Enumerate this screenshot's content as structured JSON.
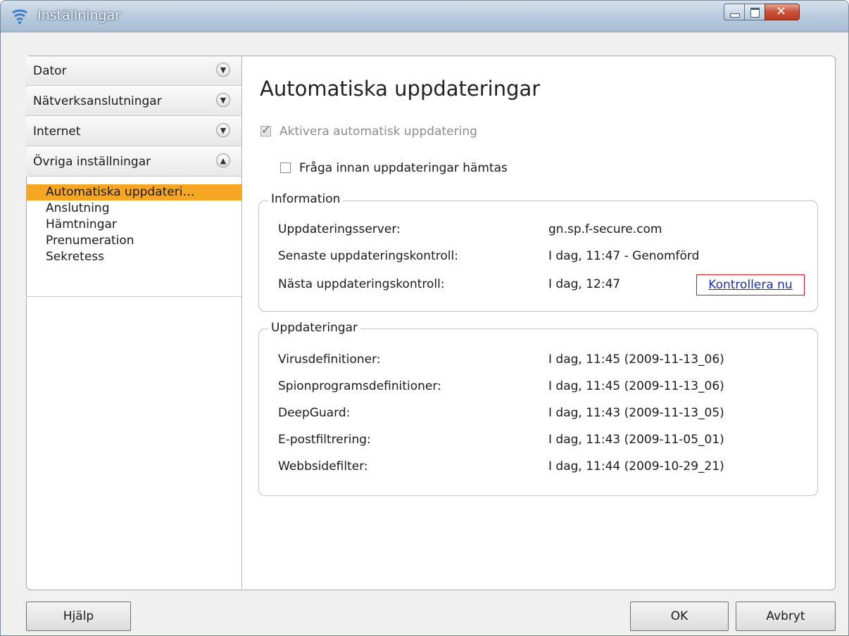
{
  "window": {
    "title": "Inställningar"
  },
  "sidebar": {
    "categories": [
      {
        "label": "Dator",
        "expanded": false
      },
      {
        "label": "Nätverksanslutningar",
        "expanded": false
      },
      {
        "label": "Internet",
        "expanded": false
      },
      {
        "label": "Övriga inställningar",
        "expanded": true
      }
    ],
    "subitems": [
      {
        "label": "Automatiska uppdateri…",
        "selected": true
      },
      {
        "label": "Anslutning",
        "selected": false
      },
      {
        "label": "Hämtningar",
        "selected": false
      },
      {
        "label": "Prenumeration",
        "selected": false
      },
      {
        "label": "Sekretess",
        "selected": false
      }
    ],
    "selected_color": "#f5a623"
  },
  "main": {
    "heading": "Automatiska uppdateringar",
    "enable_auto_update": {
      "label": "Aktivera automatisk uppdatering",
      "checked": true,
      "enabled": false
    },
    "ask_before_download": {
      "label": "Fråga innan uppdateringar hämtas",
      "checked": false
    },
    "information": {
      "title": "Information",
      "rows": [
        {
          "label": "Uppdateringsserver:",
          "value": "gn.sp.f-secure.com"
        },
        {
          "label": "Senaste uppdateringskontroll:",
          "value": "I dag, 11:47 - Genomförd"
        },
        {
          "label": "Nästa uppdateringskontroll:",
          "value": "I dag, 12:47"
        }
      ],
      "check_now_link": "Kontrollera nu"
    },
    "updates": {
      "title": "Uppdateringar",
      "rows": [
        {
          "label": "Virusdefinitioner:",
          "value": "I dag, 11:45 (2009-11-13_06)"
        },
        {
          "label": "Spionprogramsdefinitioner:",
          "value": "I dag, 11:45 (2009-11-13_06)"
        },
        {
          "label": "DeepGuard:",
          "value": "I dag, 11:43 (2009-11-13_05)"
        },
        {
          "label": "E-postfiltrering:",
          "value": "I dag, 11:43 (2009-11-05_01)"
        },
        {
          "label": "Webbsidefilter:",
          "value": "I dag, 11:44 (2009-10-29_21)"
        }
      ]
    }
  },
  "footer": {
    "help": "Hjälp",
    "ok": "OK",
    "cancel": "Avbryt"
  }
}
